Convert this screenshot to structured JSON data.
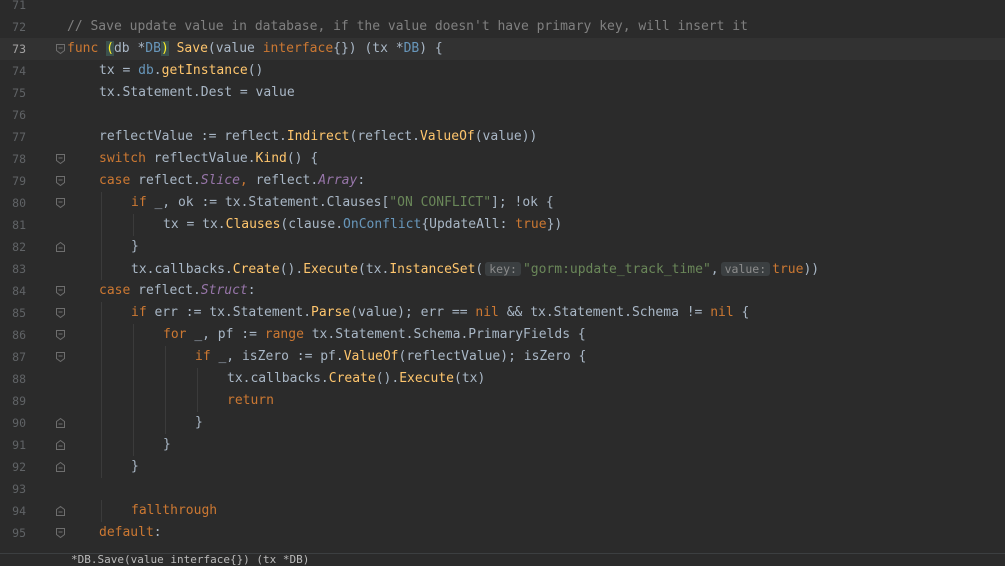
{
  "editor": {
    "language": "Go",
    "current_line": 73,
    "lines": [
      {
        "num": "71",
        "indent": 0,
        "fold": "",
        "tokens": []
      },
      {
        "num": "72",
        "indent": 0,
        "fold": "",
        "tokens": [
          {
            "t": "// Save update value in database, if the value doesn't have primary key, will insert it",
            "c": "comment"
          }
        ]
      },
      {
        "num": "73",
        "indent": 0,
        "fold": "open",
        "tokens": [
          {
            "t": "func ",
            "c": "kw"
          },
          {
            "t": "(",
            "c": "bracket-hl"
          },
          {
            "t": "db ",
            "c": ""
          },
          {
            "t": "*",
            "c": ""
          },
          {
            "t": "DB",
            "c": "type"
          },
          {
            "t": ")",
            "c": "bracket-hl"
          },
          {
            "t": " ",
            "c": ""
          },
          {
            "t": "Save",
            "c": "fn"
          },
          {
            "t": "(value ",
            "c": ""
          },
          {
            "t": "interface",
            "c": "kw"
          },
          {
            "t": "{}) (tx *",
            "c": ""
          },
          {
            "t": "DB",
            "c": "type"
          },
          {
            "t": ") {",
            "c": ""
          }
        ]
      },
      {
        "num": "74",
        "indent": 1,
        "fold": "",
        "tokens": [
          {
            "t": "tx = ",
            "c": ""
          },
          {
            "t": "db",
            "c": "recv"
          },
          {
            "t": ".",
            "c": ""
          },
          {
            "t": "getInstance",
            "c": "method"
          },
          {
            "t": "()",
            "c": ""
          }
        ]
      },
      {
        "num": "75",
        "indent": 1,
        "fold": "",
        "tokens": [
          {
            "t": "tx.Statement.Dest = value",
            "c": ""
          }
        ]
      },
      {
        "num": "76",
        "indent": 0,
        "fold": "",
        "tokens": []
      },
      {
        "num": "77",
        "indent": 1,
        "fold": "",
        "tokens": [
          {
            "t": "reflectValue := ",
            "c": ""
          },
          {
            "t": "reflect",
            "c": "pkg"
          },
          {
            "t": ".",
            "c": ""
          },
          {
            "t": "Indirect",
            "c": "method"
          },
          {
            "t": "(",
            "c": ""
          },
          {
            "t": "reflect",
            "c": "pkg"
          },
          {
            "t": ".",
            "c": ""
          },
          {
            "t": "ValueOf",
            "c": "method"
          },
          {
            "t": "(value))",
            "c": ""
          }
        ]
      },
      {
        "num": "78",
        "indent": 1,
        "fold": "open",
        "tokens": [
          {
            "t": "switch ",
            "c": "kw"
          },
          {
            "t": "reflectValue.",
            "c": ""
          },
          {
            "t": "Kind",
            "c": "method"
          },
          {
            "t": "() {",
            "c": ""
          }
        ]
      },
      {
        "num": "79",
        "indent": 1,
        "fold": "open",
        "tokens": [
          {
            "t": "case ",
            "c": "kw"
          },
          {
            "t": "reflect",
            "c": "pkg"
          },
          {
            "t": ".",
            "c": ""
          },
          {
            "t": "Slice",
            "c": "italic"
          },
          {
            "t": ", ",
            "c": "kw"
          },
          {
            "t": "reflect",
            "c": "pkg"
          },
          {
            "t": ".",
            "c": ""
          },
          {
            "t": "Array",
            "c": "italic"
          },
          {
            "t": ":",
            "c": ""
          }
        ]
      },
      {
        "num": "80",
        "indent": 2,
        "fold": "open",
        "tokens": [
          {
            "t": "if ",
            "c": "kw"
          },
          {
            "t": "_, ok := tx.Statement.Clauses[",
            "c": ""
          },
          {
            "t": "\"ON CONFLICT\"",
            "c": "str"
          },
          {
            "t": "]; !ok {",
            "c": ""
          }
        ]
      },
      {
        "num": "81",
        "indent": 3,
        "fold": "",
        "tokens": [
          {
            "t": "tx = tx.",
            "c": ""
          },
          {
            "t": "Clauses",
            "c": "method"
          },
          {
            "t": "(",
            "c": ""
          },
          {
            "t": "clause",
            "c": "pkg"
          },
          {
            "t": ".",
            "c": ""
          },
          {
            "t": "OnConflict",
            "c": "type"
          },
          {
            "t": "{UpdateAll: ",
            "c": ""
          },
          {
            "t": "true",
            "c": "kw"
          },
          {
            "t": "})",
            "c": ""
          }
        ]
      },
      {
        "num": "82",
        "indent": 2,
        "fold": "close",
        "tokens": [
          {
            "t": "}",
            "c": ""
          }
        ]
      },
      {
        "num": "83",
        "indent": 2,
        "fold": "",
        "tokens": [
          {
            "t": "tx.callbacks.",
            "c": ""
          },
          {
            "t": "Create",
            "c": "method"
          },
          {
            "t": "().",
            "c": ""
          },
          {
            "t": "Execute",
            "c": "method"
          },
          {
            "t": "(tx.",
            "c": ""
          },
          {
            "t": "InstanceSet",
            "c": "method"
          },
          {
            "t": "(",
            "c": ""
          },
          {
            "t": "key:",
            "c": "hint"
          },
          {
            "t": "\"gorm:update_track_time\"",
            "c": "str"
          },
          {
            "t": ",",
            "c": ""
          },
          {
            "t": "value:",
            "c": "hint"
          },
          {
            "t": "true",
            "c": "kw"
          },
          {
            "t": "))",
            "c": ""
          }
        ]
      },
      {
        "num": "84",
        "indent": 1,
        "fold": "open",
        "tokens": [
          {
            "t": "case ",
            "c": "kw"
          },
          {
            "t": "reflect",
            "c": "pkg"
          },
          {
            "t": ".",
            "c": ""
          },
          {
            "t": "Struct",
            "c": "italic"
          },
          {
            "t": ":",
            "c": ""
          }
        ]
      },
      {
        "num": "85",
        "indent": 2,
        "fold": "open",
        "tokens": [
          {
            "t": "if ",
            "c": "kw"
          },
          {
            "t": "err := tx.Statement.",
            "c": ""
          },
          {
            "t": "Parse",
            "c": "method"
          },
          {
            "t": "(value); err == ",
            "c": ""
          },
          {
            "t": "nil",
            "c": "kw"
          },
          {
            "t": " && tx.Statement.Schema != ",
            "c": ""
          },
          {
            "t": "nil",
            "c": "kw"
          },
          {
            "t": " {",
            "c": ""
          }
        ]
      },
      {
        "num": "86",
        "indent": 3,
        "fold": "open",
        "tokens": [
          {
            "t": "for ",
            "c": "kw"
          },
          {
            "t": "_, pf := ",
            "c": ""
          },
          {
            "t": "range ",
            "c": "kw"
          },
          {
            "t": "tx.Statement.Schema.PrimaryFields {",
            "c": ""
          }
        ]
      },
      {
        "num": "87",
        "indent": 4,
        "fold": "open",
        "tokens": [
          {
            "t": "if ",
            "c": "kw"
          },
          {
            "t": "_, isZero := pf.",
            "c": ""
          },
          {
            "t": "ValueOf",
            "c": "method"
          },
          {
            "t": "(reflectValue); isZero {",
            "c": ""
          }
        ]
      },
      {
        "num": "88",
        "indent": 5,
        "fold": "",
        "tokens": [
          {
            "t": "tx.callbacks.",
            "c": ""
          },
          {
            "t": "Create",
            "c": "method"
          },
          {
            "t": "().",
            "c": ""
          },
          {
            "t": "Execute",
            "c": "method"
          },
          {
            "t": "(tx)",
            "c": ""
          }
        ]
      },
      {
        "num": "89",
        "indent": 5,
        "fold": "",
        "tokens": [
          {
            "t": "return",
            "c": "kw"
          }
        ]
      },
      {
        "num": "90",
        "indent": 4,
        "fold": "close",
        "tokens": [
          {
            "t": "}",
            "c": ""
          }
        ]
      },
      {
        "num": "91",
        "indent": 3,
        "fold": "close",
        "tokens": [
          {
            "t": "}",
            "c": ""
          }
        ]
      },
      {
        "num": "92",
        "indent": 2,
        "fold": "close",
        "tokens": [
          {
            "t": "}",
            "c": ""
          }
        ]
      },
      {
        "num": "93",
        "indent": 0,
        "fold": "",
        "tokens": []
      },
      {
        "num": "94",
        "indent": 2,
        "fold": "close",
        "tokens": [
          {
            "t": "fallthrough",
            "c": "kw"
          }
        ]
      },
      {
        "num": "95",
        "indent": 1,
        "fold": "open",
        "tokens": [
          {
            "t": "default",
            "c": "kw"
          },
          {
            "t": ":",
            "c": ""
          }
        ]
      }
    ]
  },
  "statusbar": {
    "breadcrumb": "*DB.Save(value interface{}) (tx *DB)"
  }
}
